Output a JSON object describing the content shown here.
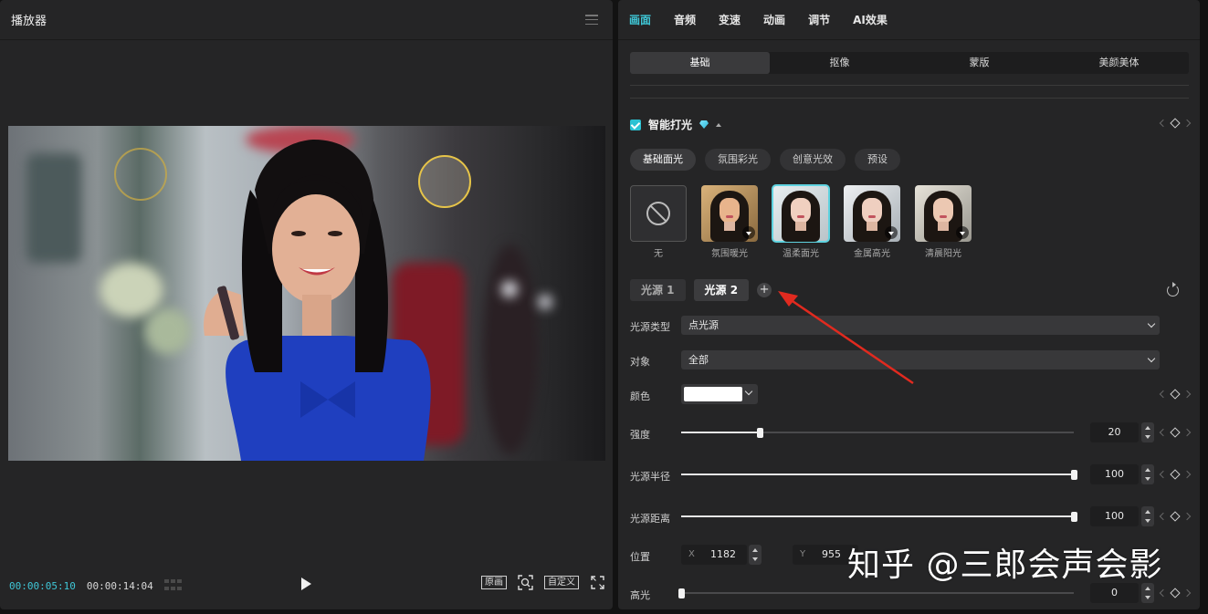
{
  "player": {
    "title": "播放器",
    "timecode_current": "00:00:05:10",
    "timecode_total": "00:00:14:04",
    "btn_original": "原画",
    "btn_custom": "自定义"
  },
  "props": {
    "tabs": [
      {
        "label": "画面"
      },
      {
        "label": "音频"
      },
      {
        "label": "变速"
      },
      {
        "label": "动画"
      },
      {
        "label": "调节"
      },
      {
        "label": "AI效果"
      }
    ],
    "subtabs": [
      {
        "label": "基础"
      },
      {
        "label": "抠像"
      },
      {
        "label": "蒙版"
      },
      {
        "label": "美颜美体"
      }
    ],
    "section_title": "智能打光",
    "pills": [
      {
        "label": "基础面光"
      },
      {
        "label": "氛围彩光"
      },
      {
        "label": "创意光效"
      },
      {
        "label": "预设"
      }
    ],
    "presets": [
      {
        "label": "无"
      },
      {
        "label": "氛围暖光"
      },
      {
        "label": "温柔面光"
      },
      {
        "label": "金属高光"
      },
      {
        "label": "清晨阳光"
      }
    ],
    "light_sources": [
      {
        "label": "光源 1"
      },
      {
        "label": "光源 2"
      }
    ],
    "add_symbol": "+",
    "light_type": {
      "label": "光源类型",
      "value": "点光源"
    },
    "target": {
      "label": "对象",
      "value": "全部"
    },
    "color": {
      "label": "颜色",
      "value": "#ffffff"
    },
    "intensity": {
      "label": "强度",
      "value": "20",
      "fraction": 0.2
    },
    "radius": {
      "label": "光源半径",
      "value": "100",
      "fraction": 1.0
    },
    "distance": {
      "label": "光源距离",
      "value": "100",
      "fraction": 1.0
    },
    "position": {
      "label": "位置",
      "x_axis": "X",
      "x": "1182",
      "y_axis": "Y",
      "y": "955"
    },
    "highlight": {
      "label": "高光",
      "value": "0",
      "fraction": 0.0
    }
  },
  "watermark": "知乎 @三郎会声会影",
  "colors": {
    "accent": "#3fc6d6",
    "arrow": "#e12a1f",
    "ring": "#e6c449"
  }
}
